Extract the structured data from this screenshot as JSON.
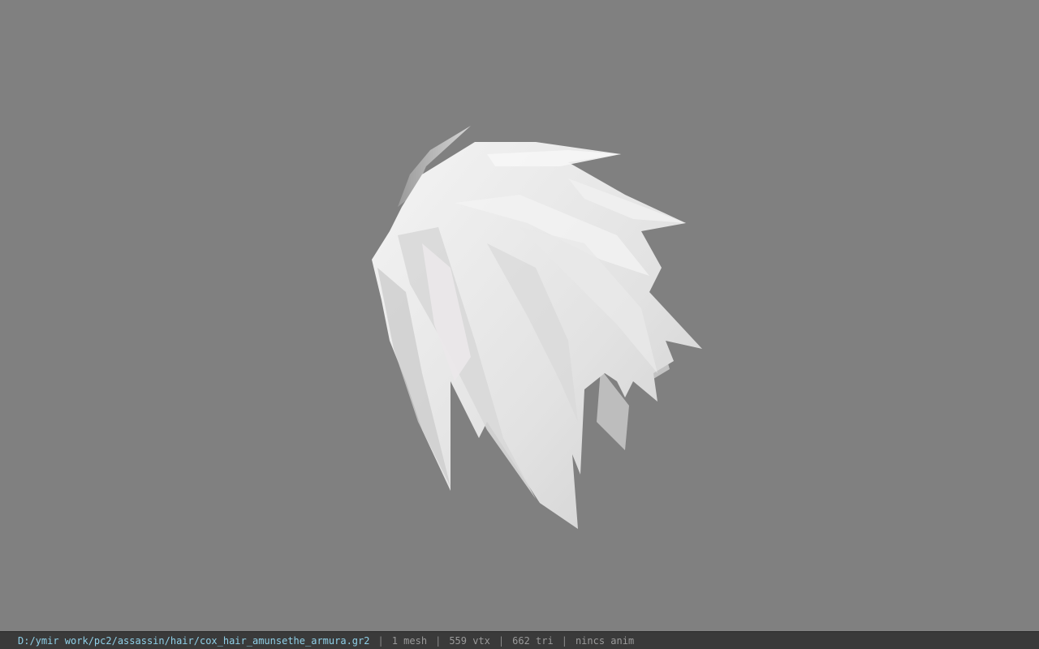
{
  "app": {
    "viewport_bg": "#808080",
    "model_color": "#e8e8e8"
  },
  "status": {
    "path": "D:/ymir work/pc2/assassin/hair/cox_hair_amunsethe_armura.gr2",
    "separator": "|",
    "mesh": "1 mesh",
    "vertices": "559 vtx",
    "triangles": "662 tri",
    "anim": "nincs anim"
  }
}
